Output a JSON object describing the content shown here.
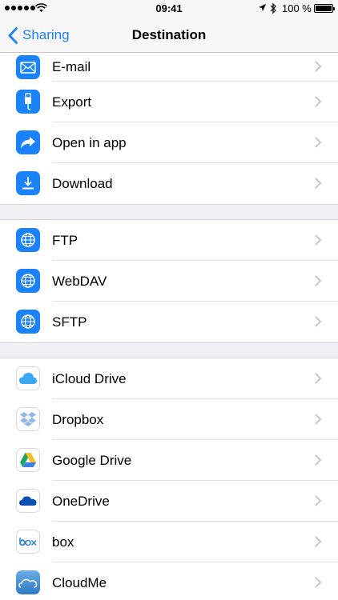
{
  "status_bar": {
    "time": "09:41",
    "battery": "100 %"
  },
  "nav": {
    "back_label": "Sharing",
    "title": "Destination"
  },
  "sections": [
    {
      "items": [
        {
          "label": "E-mail",
          "icon": "mail-icon"
        },
        {
          "label": "Export",
          "icon": "usb-cable-icon"
        },
        {
          "label": "Open in app",
          "icon": "share-arrow-icon"
        },
        {
          "label": "Download",
          "icon": "download-icon"
        }
      ]
    },
    {
      "items": [
        {
          "label": "FTP",
          "icon": "globe-icon"
        },
        {
          "label": "WebDAV",
          "icon": "globe-icon"
        },
        {
          "label": "SFTP",
          "icon": "globe-icon"
        }
      ]
    },
    {
      "items": [
        {
          "label": "iCloud Drive",
          "icon": "icloud-icon"
        },
        {
          "label": "Dropbox",
          "icon": "dropbox-icon"
        },
        {
          "label": "Google Drive",
          "icon": "google-drive-icon"
        },
        {
          "label": "OneDrive",
          "icon": "onedrive-icon"
        },
        {
          "label": "box",
          "icon": "box-logo-icon"
        },
        {
          "label": "CloudMe",
          "icon": "cloudme-icon"
        }
      ]
    }
  ],
  "colors": {
    "accent": "#1a82fb",
    "group_background": "#efeff4"
  }
}
